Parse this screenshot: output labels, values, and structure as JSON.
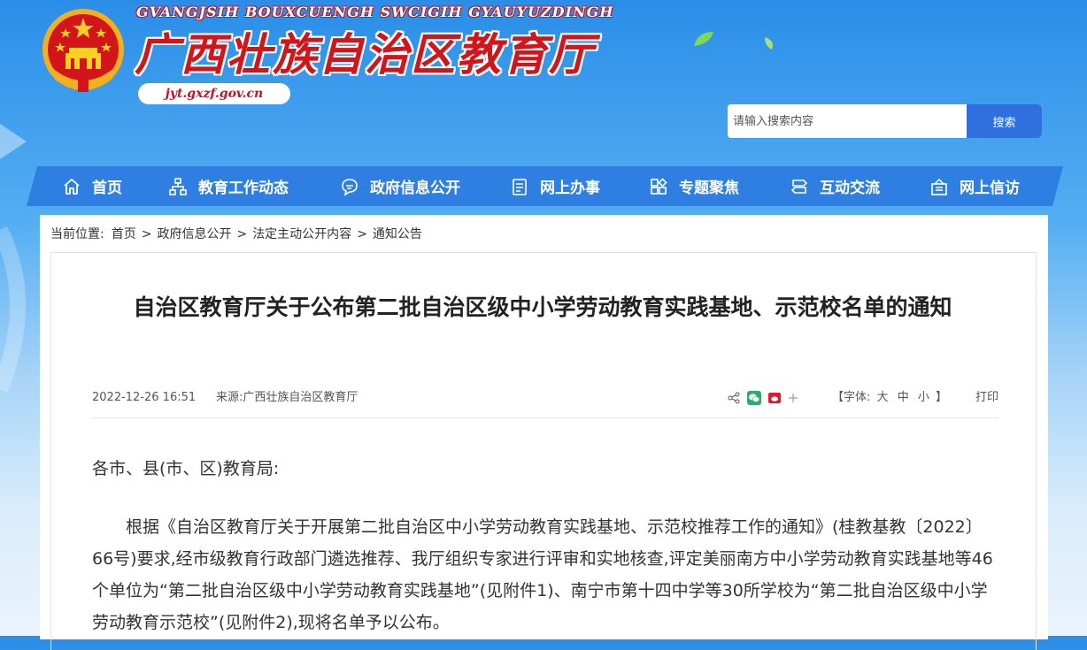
{
  "header": {
    "subtitle": "GVANGJSIH BOUXCUENGH SWCIGIH GYAUYUZDINGH",
    "title": "广西壮族自治区教育厅",
    "domain": "jyt.gxzf.gov.cn"
  },
  "search": {
    "placeholder": "请输入搜索内容",
    "button_label": "搜索"
  },
  "nav": {
    "items": [
      {
        "label": "首页",
        "icon": "home-icon"
      },
      {
        "label": "教育工作动态",
        "icon": "org-chart-icon"
      },
      {
        "label": "政府信息公开",
        "icon": "chat-icon"
      },
      {
        "label": "网上办事",
        "icon": "document-icon"
      },
      {
        "label": "专题聚焦",
        "icon": "grid-icon"
      },
      {
        "label": "互动交流",
        "icon": "signpost-icon"
      },
      {
        "label": "网上信访",
        "icon": "mailbox-icon"
      }
    ]
  },
  "breadcrumb": {
    "prefix": "当前位置:",
    "items": [
      "首页",
      "政府信息公开",
      "法定主动公开内容",
      "通知公告"
    ],
    "separator": ">"
  },
  "article": {
    "title": "自治区教育厅关于公布第二批自治区级中小学劳动教育实践基地、示范校名单的通知",
    "date": "2022-12-26 16:51",
    "source": "来源:广西壮族自治区教育厅",
    "font_size_label": "【字体:",
    "font_sizes": [
      "大",
      "中",
      "小"
    ],
    "font_size_close": "】",
    "print_label": "打印",
    "salutation": "各市、县(市、区)教育局:",
    "paragraph": "根据《自治区教育厅关于开展第二批自治区中小学劳动教育实践基地、示范校推荐工作的通知》(桂教基教〔2022〕66号)要求,经市级教育行政部门遴选推荐、我厅组织专家进行评审和实地核查,评定美丽南方中小学劳动教育实践基地等46个单位为“第二批自治区级中小学劳动教育实践基地”(见附件1)、南宁市第十四中学等30所学校为“第二批自治区级中小学劳动教育示范校”(见附件2),现将名单予以公布。"
  },
  "share": {
    "icons": [
      "share-icon",
      "wechat-icon",
      "weibo-icon",
      "plus-icon"
    ]
  },
  "colors": {
    "nav_bg": "#2f7fe2",
    "title_red": "#d4141b",
    "search_button": "#2f6fde"
  }
}
